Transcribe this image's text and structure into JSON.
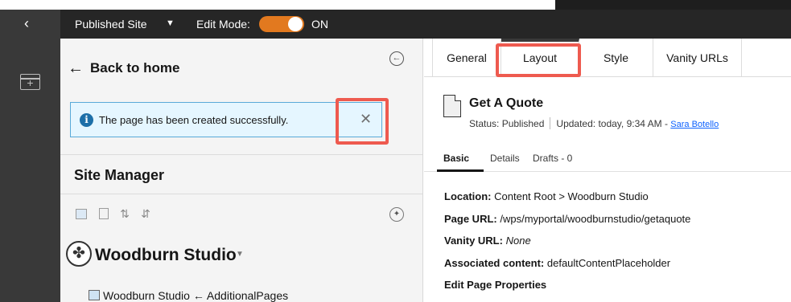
{
  "topbar": {
    "back_icon": "chevron-left-icon",
    "site_label": "Published Site",
    "site_caret": "▼",
    "edit_mode_label": "Edit Mode:",
    "edit_mode_state": "ON",
    "toggle_color": "#e2791f"
  },
  "left": {
    "back_label": "Back to home",
    "notification": "The page has been created successfully.",
    "close_glyph": "✕",
    "site_manager_title": "Site Manager",
    "site_name": "Woodburn Studio",
    "tree_item": "Woodburn Studio ← AdditionalPages",
    "highlight_color": "#ee5a4f"
  },
  "right": {
    "tabs": [
      "General",
      "Layout",
      "Style",
      "Vanity URLs"
    ],
    "page_title": "Get A Quote",
    "status": "Status: Published",
    "updated": "Updated: today, 9:34 AM -",
    "author": "Sara Botello",
    "subtabs": [
      "Basic",
      "Details",
      "Drafts - 0"
    ],
    "location_label": "Location:",
    "location_value": "Content Root > Woodburn Studio",
    "page_url_label": "Page URL:",
    "page_url_value": "/wps/myportal/woodburnstudio/getaquote",
    "vanity_label": "Vanity URL:",
    "vanity_value": "None",
    "assoc_label": "Associated content:",
    "assoc_value": "defaultContentPlaceholder",
    "edit_props": "Edit Page Properties"
  }
}
